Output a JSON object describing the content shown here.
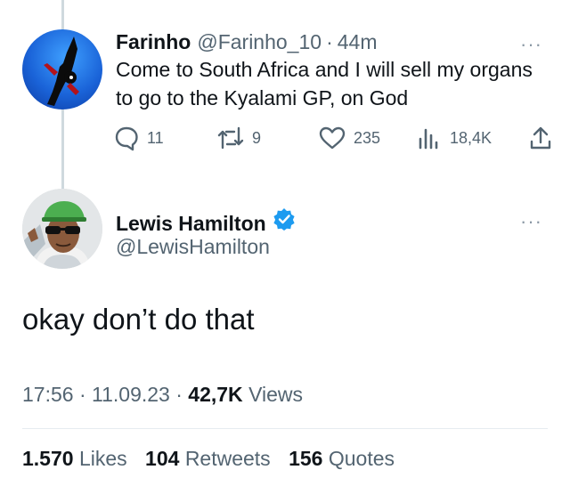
{
  "reply_parent": {
    "display_name": "Farinho",
    "handle": "@Farinho_10",
    "separator": "·",
    "time_ago": "44m",
    "text": "Come to South Africa and I will sell my organs to go to the Kyalami GP, on God",
    "more_icon": "more-dots-icon",
    "actions": {
      "replies": "11",
      "retweets": "9",
      "likes": "235",
      "views": "18,4K"
    }
  },
  "main_tweet": {
    "display_name": "Lewis Hamilton",
    "handle": "@LewisHamilton",
    "verified": true,
    "text": "okay don’t do that",
    "time": "17:56",
    "date": "11.09.23",
    "views_count": "42,7K",
    "views_label": "Views",
    "stats": {
      "likes_count": "1.570",
      "likes_label": "Likes",
      "retweets_count": "104",
      "retweets_label": "Retweets",
      "quotes_count": "156",
      "quotes_label": "Quotes"
    }
  },
  "colors": {
    "text": "#0f1419",
    "secondary": "#536471",
    "verified": "#1d9bf0",
    "thread_line": "#cfd9de"
  }
}
